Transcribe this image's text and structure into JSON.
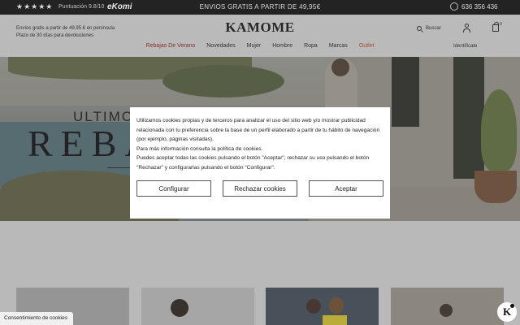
{
  "topbar": {
    "stars": "★★★★★",
    "rating": "Puntuación 9.8/10",
    "ekomi": "eKomi",
    "promo": "ENVIOS GRATIS A PARTIR DE 49,95€",
    "phone": "636 356 436"
  },
  "header": {
    "shipping_line1": "Envíos gratis a partir de 49,95 € en península",
    "shipping_line2": "Plazo de 30 días para devoluciones",
    "logo": "KAMOME",
    "search_label": "Buscar",
    "bag_count": "0",
    "identify_label": "Identifícate"
  },
  "nav": {
    "items": [
      "Rebajas De Verano",
      "Novedades",
      "Mujer",
      "Hombre",
      "Ropa",
      "Marcas",
      "Outlet"
    ]
  },
  "hero": {
    "title_small": "ULTIMOS",
    "title_big": "REBA"
  },
  "cookie": {
    "text1": "Utilizamos cookies propias y de terceros para analizar el uso del sitio web y/o mostrar publicidad relacionada con tu preferencia sobre la base de un perfil elaborado a partir de tu hábito de navegación (por ejemplo, páginas visitadas).",
    "text2": "Para más información consulta la política de cookies.",
    "text3": "Puedes aceptar todas las cookies pulsando el botón \"Aceptar\", rechazar su uso pulsando el botón \"Rechazar\" y configurarlas pulsando el botón \"Configurar\".",
    "configure_label": "Configurar",
    "reject_label": "Rechazar cookies",
    "accept_label": "Aceptar"
  },
  "consent_tab": "Consentimiento de cookies",
  "badge": "K",
  "icons": [
    "star-icon",
    "whatsapp-icon",
    "search-icon",
    "user-icon",
    "bag-icon"
  ]
}
